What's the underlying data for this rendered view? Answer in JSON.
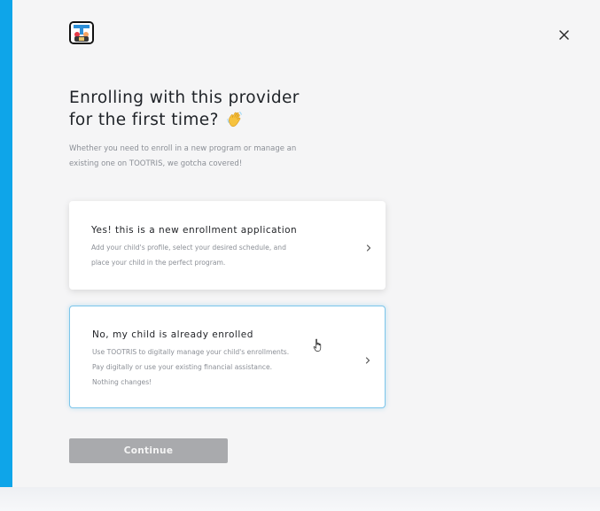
{
  "modal": {
    "title_line1": "Enrolling with this provider",
    "title_line2": "for the first time?",
    "title_emoji": "waving-hand-icon",
    "subtitle_line1": "Whether you need to enroll in a new program or manage an",
    "subtitle_line2": "existing one on TOOTRIS, we gotcha covered!",
    "close_icon": "close-icon",
    "logo_icon": "tootris-logo"
  },
  "options": [
    {
      "title": "Yes! this is a new enrollment application",
      "desc_lines": [
        "Add your child's profile, select your desired schedule, and",
        "place your child in the perfect program."
      ],
      "icon": "chevron-right-icon",
      "selected": false
    },
    {
      "title": "No, my child is already enrolled",
      "desc_lines": [
        "Use TOOTRIS to digitally manage your child's enrollments.",
        "Pay digitally or use your existing financial assistance.",
        "Nothing changes!"
      ],
      "icon": "chevron-right-icon",
      "selected": true
    }
  ],
  "footer": {
    "continue_label": "Continue",
    "continue_enabled": false
  },
  "colors": {
    "accent_bar": "#0ea5e9",
    "selected_border": "#7cc5ea",
    "continue_bg": "#a9aaad",
    "title_text": "#1f2328",
    "muted_text": "#8b8f96"
  }
}
